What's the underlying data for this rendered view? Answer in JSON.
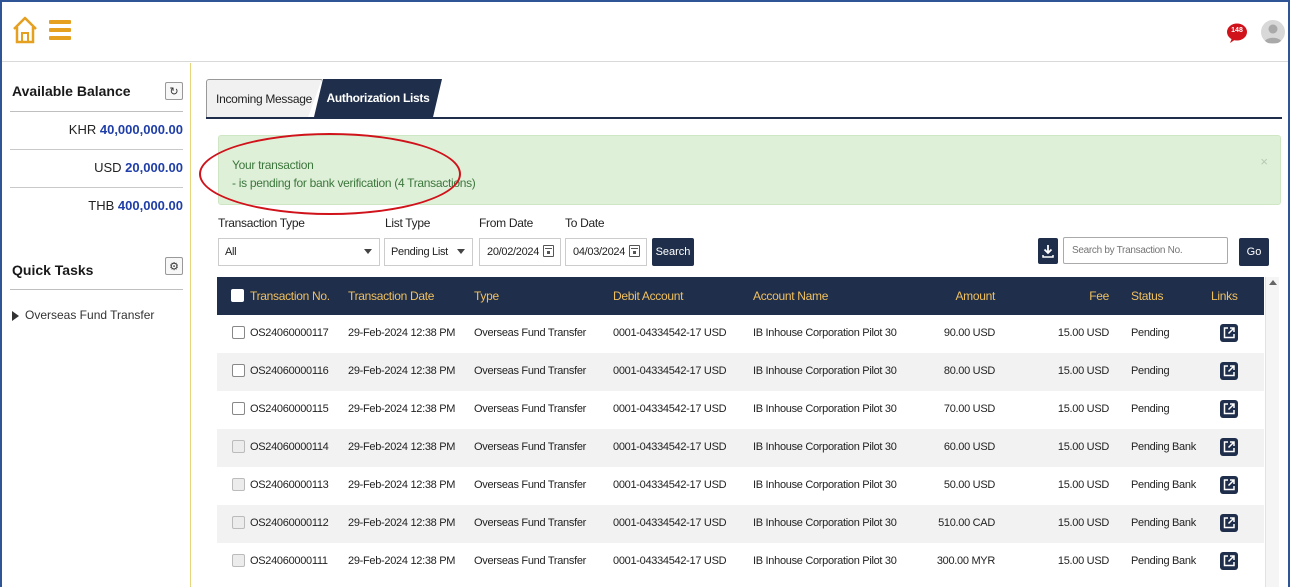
{
  "topbar": {
    "notification_count": "148"
  },
  "sidebar": {
    "balance_title": "Available Balance",
    "balances": [
      {
        "currency": "KHR",
        "amount": "40,000,000.00"
      },
      {
        "currency": "USD",
        "amount": "20,000.00"
      },
      {
        "currency": "THB",
        "amount": "400,000.00"
      }
    ],
    "quick_tasks_title": "Quick Tasks",
    "tasks": [
      {
        "label": "Overseas Fund Transfer"
      }
    ]
  },
  "tabs": [
    {
      "label": "Incoming Message",
      "active": false
    },
    {
      "label": "Authorization Lists",
      "active": true
    }
  ],
  "alert": {
    "line1": "Your transaction",
    "line2": "- is pending for bank verification (4 Transactions)",
    "close": "×"
  },
  "filters": {
    "transaction_type_label": "Transaction Type",
    "transaction_type_value": "All",
    "list_type_label": "List Type",
    "list_type_value": "Pending List",
    "from_date_label": "From Date",
    "from_date_value": "20/02/2024",
    "to_date_label": "To Date",
    "to_date_value": "04/03/2024",
    "search_button": "Search",
    "search_placeholder": "Search by Transaction No.",
    "go_button": "Go"
  },
  "table": {
    "headers": {
      "transaction_no": "Transaction No.",
      "transaction_date": "Transaction Date",
      "type": "Type",
      "debit_account": "Debit Account",
      "account_name": "Account Name",
      "amount": "Amount",
      "fee": "Fee",
      "status": "Status",
      "links": "Links"
    },
    "rows": [
      {
        "no": "OS24060000117",
        "date": "29-Feb-2024 12:38 PM",
        "type": "Overseas Fund Transfer",
        "debit": "0001-04334542-17 USD",
        "name": "IB Inhouse Corporation Pilot 30",
        "amount": "90.00 USD",
        "fee": "15.00 USD",
        "status": "Pending"
      },
      {
        "no": "OS24060000116",
        "date": "29-Feb-2024 12:38 PM",
        "type": "Overseas Fund Transfer",
        "debit": "0001-04334542-17 USD",
        "name": "IB Inhouse Corporation Pilot 30",
        "amount": "80.00 USD",
        "fee": "15.00 USD",
        "status": "Pending"
      },
      {
        "no": "OS24060000115",
        "date": "29-Feb-2024 12:38 PM",
        "type": "Overseas Fund Transfer",
        "debit": "0001-04334542-17 USD",
        "name": "IB Inhouse Corporation Pilot 30",
        "amount": "70.00 USD",
        "fee": "15.00 USD",
        "status": "Pending"
      },
      {
        "no": "OS24060000114",
        "date": "29-Feb-2024 12:38 PM",
        "type": "Overseas Fund Transfer",
        "debit": "0001-04334542-17 USD",
        "name": "IB Inhouse Corporation Pilot 30",
        "amount": "60.00 USD",
        "fee": "15.00 USD",
        "status": "Pending Bank"
      },
      {
        "no": "OS24060000113",
        "date": "29-Feb-2024 12:38 PM",
        "type": "Overseas Fund Transfer",
        "debit": "0001-04334542-17 USD",
        "name": "IB Inhouse Corporation Pilot 30",
        "amount": "50.00 USD",
        "fee": "15.00 USD",
        "status": "Pending Bank"
      },
      {
        "no": "OS24060000112",
        "date": "29-Feb-2024 12:38 PM",
        "type": "Overseas Fund Transfer",
        "debit": "0001-04334542-17 USD",
        "name": "IB Inhouse Corporation Pilot 30",
        "amount": "510.00 CAD",
        "fee": "15.00 USD",
        "status": "Pending Bank"
      },
      {
        "no": "OS24060000111",
        "date": "29-Feb-2024 12:38 PM",
        "type": "Overseas Fund Transfer",
        "debit": "0001-04334542-17 USD",
        "name": "IB Inhouse Corporation Pilot 30",
        "amount": "300.00 MYR",
        "fee": "15.00 USD",
        "status": "Pending Bank"
      }
    ]
  },
  "colors": {
    "navy": "#1f2e4a",
    "accent_orange": "#e6a020",
    "header_text": "#f0c060",
    "alert_bg": "#dff0d8",
    "alert_text": "#3c763d",
    "annotation_red": "#d0121b",
    "balance_blue": "#1f3ea8"
  }
}
